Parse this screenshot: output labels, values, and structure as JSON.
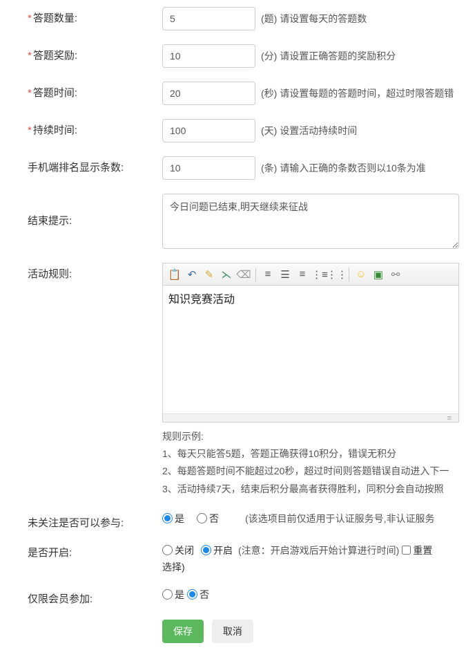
{
  "fields": {
    "count": {
      "label": "答题数量:",
      "required": true,
      "value": "5",
      "unit_hint": "(题) 请设置每天的答题数"
    },
    "reward": {
      "label": "答题奖励:",
      "required": true,
      "value": "10",
      "unit_hint": "(分) 请设置正确答题的奖励积分"
    },
    "time": {
      "label": "答题时间:",
      "required": true,
      "value": "20",
      "unit_hint": "(秒) 请设置每题的答题时间，超过时限答题错"
    },
    "duration": {
      "label": "持续时间:",
      "required": true,
      "value": "100",
      "unit_hint": "(天) 设置活动持续时间"
    },
    "rank_rows": {
      "label": "手机端排名显示条数:",
      "required": false,
      "value": "10",
      "unit_hint": "(条) 请输入正确的条数否则以10条为准"
    },
    "end_prompt": {
      "label": "结束提示:",
      "value": "今日问题已结束,明天继续来征战"
    },
    "rules": {
      "label": "活动规则:",
      "editor_content": "知识竞赛活动",
      "example_title": "规则示例:",
      "example_lines": [
        "1、每天只能答5题，答题正确获得10积分，错误无积分",
        "2、每题答题时间不能超过20秒，超过时间则答题错误自动进入下一",
        "3、活动持续7天，结束后积分最高者获得胜利，同积分会自动按照"
      ]
    },
    "unfollow": {
      "label": "未关注是否可以参与:",
      "yes": "是",
      "no": "否",
      "note": "(该选项目前仅适用于认证服务号,非认证服务"
    },
    "enable": {
      "label": "是否开启:",
      "close": "关闭",
      "open": "开启",
      "note": "(注意：开启游戏后开始计算进行时间)",
      "reset": "重置",
      "extra": "选择)"
    },
    "member_only": {
      "label": "仅限会员参加:",
      "yes": "是",
      "no": "否"
    }
  },
  "buttons": {
    "save": "保存",
    "cancel": "取消"
  },
  "editor_footer_glyph": "≡",
  "req_mark": "*"
}
